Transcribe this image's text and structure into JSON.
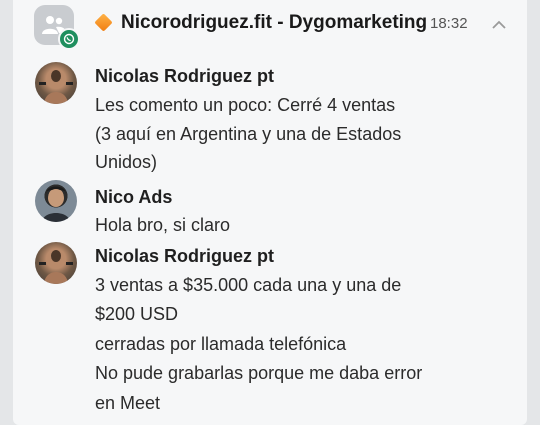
{
  "header": {
    "title": "Nicorodriguez.fit - Dygomarketing",
    "time": "18:32",
    "group_icon": "group-icon",
    "app_badge": "whatsapp-icon",
    "expand_icon": "chevron-up-icon"
  },
  "messages": [
    {
      "sender": "Nicolas Rodriguez pt",
      "lines": [
        "Les comento un poco: Cerré 4 ventas",
        "(3 aquí en Argentina y una de Estados",
        "Unidos)"
      ]
    },
    {
      "sender": "Nico Ads",
      "lines": [
        "Hola bro, si claro"
      ]
    },
    {
      "sender": "Nicolas Rodriguez pt",
      "lines": [
        "3 ventas a $35.000 cada una y una de",
        "$200 USD",
        "cerradas por llamada telefónica",
        "No pude grabarlas porque me daba error",
        "en Meet"
      ]
    }
  ],
  "colors": {
    "background": "#e4e6e8",
    "card": "#f6f7f8",
    "badge": "#1f8f5f",
    "diamond": "#f07d12"
  }
}
